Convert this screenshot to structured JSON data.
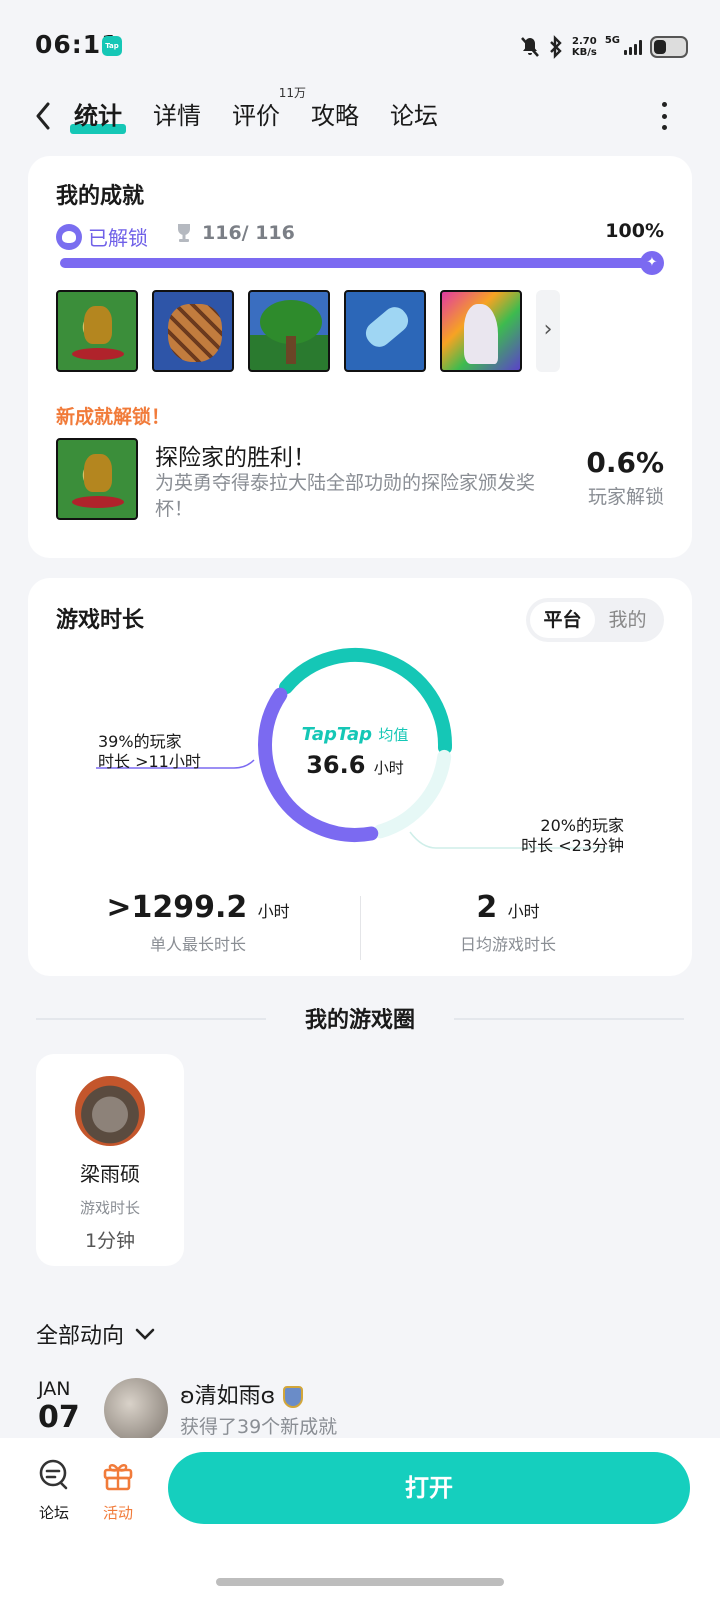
{
  "status": {
    "time": "06:11",
    "app_badge": "Tap",
    "net_speed": "2.70",
    "net_unit": "KB/s",
    "network": "5G"
  },
  "tabs": [
    {
      "label": "统计",
      "active": true
    },
    {
      "label": "详情"
    },
    {
      "label": "评价",
      "badge": "11万"
    },
    {
      "label": "攻略"
    },
    {
      "label": "论坛"
    }
  ],
  "achievements": {
    "title": "我的成就",
    "unlocked_label": "已解锁",
    "count": "116/ 116",
    "percent_text": "100%",
    "progress": 1.0,
    "icon_names": [
      "trophy",
      "meteorite-bag",
      "living-tree",
      "water-bottle",
      "unicorn"
    ],
    "new_unlock_label": "新成就解锁！",
    "new_title": "探险家的胜利！",
    "new_desc": "为英勇夺得泰拉大陆全部功勋的探险家颁发奖杯！",
    "rarity": "0.6%",
    "rarity_label": "玩家解锁"
  },
  "playtime": {
    "title": "游戏时长",
    "toggle": [
      "平台",
      "我的"
    ],
    "brand": "TapTap",
    "brand_suffix": "均值",
    "avg_value": "36.6",
    "avg_unit": "小时",
    "left_label_1": "39%的玩家",
    "left_label_2": "时长 >11小时",
    "right_label_1": "20%的玩家",
    "right_label_2": "时长 <23分钟",
    "segments": {
      "long_pct": 39,
      "short_pct": 20
    },
    "max_value": ">1299.2",
    "max_unit": "小时",
    "max_label": "单人最长时长",
    "daily_value": "2",
    "daily_unit": "小时",
    "daily_label": "日均游戏时长",
    "colors": {
      "teal": "#15c7b6",
      "purple": "#7b6af1",
      "light": "#e6f8f6"
    }
  },
  "circle": {
    "title": "我的游戏圈",
    "friend_name": "梁雨硕",
    "friend_label": "游戏时长",
    "friend_time": "1分钟"
  },
  "dynamics": {
    "filter": "全部动向",
    "month": "JAN",
    "day": "07",
    "user": "ʚ清如雨ɞ",
    "action": "获得了39个新成就"
  },
  "bottom": {
    "forum": "论坛",
    "activity": "活动",
    "open": "打开",
    "activity_color": "#f17b3a"
  }
}
